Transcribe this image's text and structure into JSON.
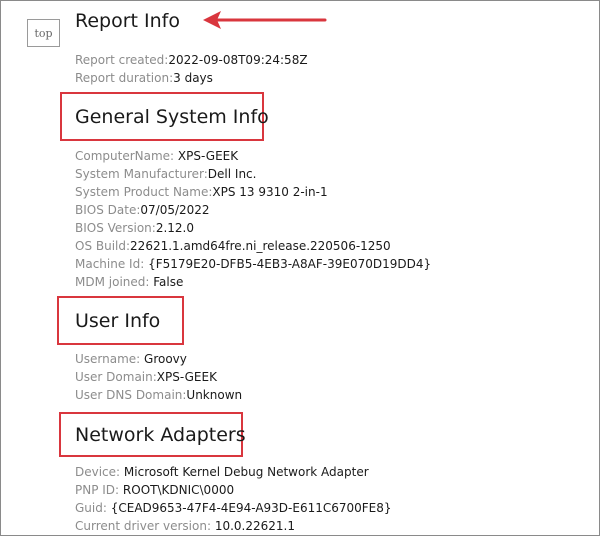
{
  "top_button": {
    "label": "top"
  },
  "report_info": {
    "heading": "Report Info",
    "created_label": "Report created:",
    "created_value": "2022-09-08T09:24:58Z",
    "duration_label": "Report duration:",
    "duration_value": "3 days"
  },
  "general_system_info": {
    "heading": "General System Info",
    "rows": [
      {
        "label": "ComputerName: ",
        "value": "XPS-GEEK"
      },
      {
        "label": "System Manufacturer:",
        "value": "Dell Inc."
      },
      {
        "label": "System Product Name:",
        "value": "XPS 13 9310 2-in-1"
      },
      {
        "label": "BIOS Date:",
        "value": "07/05/2022"
      },
      {
        "label": "BIOS Version:",
        "value": "2.12.0"
      },
      {
        "label": "OS Build:",
        "value": "22621.1.amd64fre.ni_release.220506-1250"
      },
      {
        "label": "Machine Id: ",
        "value": "{F5179E20-DFB5-4EB3-A8AF-39E070D19DD4}"
      },
      {
        "label": "MDM joined: ",
        "value": "False"
      }
    ]
  },
  "user_info": {
    "heading": "User Info",
    "rows": [
      {
        "label": "Username: ",
        "value": "Groovy"
      },
      {
        "label": "User Domain:",
        "value": "XPS-GEEK"
      },
      {
        "label": "User DNS Domain:",
        "value": "Unknown"
      }
    ]
  },
  "network_adapters": {
    "heading": "Network Adapters",
    "rows": [
      {
        "label": "Device: ",
        "value": "Microsoft Kernel Debug Network Adapter"
      },
      {
        "label": "PNP ID: ",
        "value": "ROOT\\KDNIC\\0000"
      },
      {
        "label": "Guid: ",
        "value": "{CEAD9653-47F4-4E94-A93D-E611C6700FE8}"
      },
      {
        "label": "Current driver version: ",
        "value": "10.0.22621.1"
      }
    ]
  },
  "annotation_color": "#d9363e"
}
